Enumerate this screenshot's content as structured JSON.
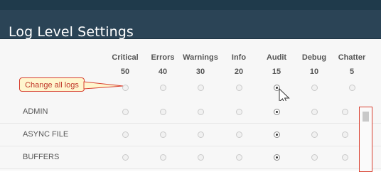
{
  "window": {
    "title": "Log Level Settings"
  },
  "columns": [
    {
      "label": "Critical",
      "level": "50"
    },
    {
      "label": "Errors",
      "level": "40"
    },
    {
      "label": "Warnings",
      "level": "30"
    },
    {
      "label": "Info",
      "level": "20"
    },
    {
      "label": "Audit",
      "level": "15"
    },
    {
      "label": "Debug",
      "level": "10"
    },
    {
      "label": "Chatter",
      "level": "5"
    }
  ],
  "change_all": {
    "label": "Change all logs",
    "selected_column": "Audit"
  },
  "rows": [
    {
      "name": "ADMIN",
      "selected_column": "Audit"
    },
    {
      "name": "ASYNC FILE",
      "selected_column": "Audit"
    },
    {
      "name": "BUFFERS",
      "selected_column": "Audit"
    }
  ],
  "colors": {
    "header": "#2b4456",
    "accent_red": "#d84030",
    "callout_fill": "#fff6ce"
  }
}
